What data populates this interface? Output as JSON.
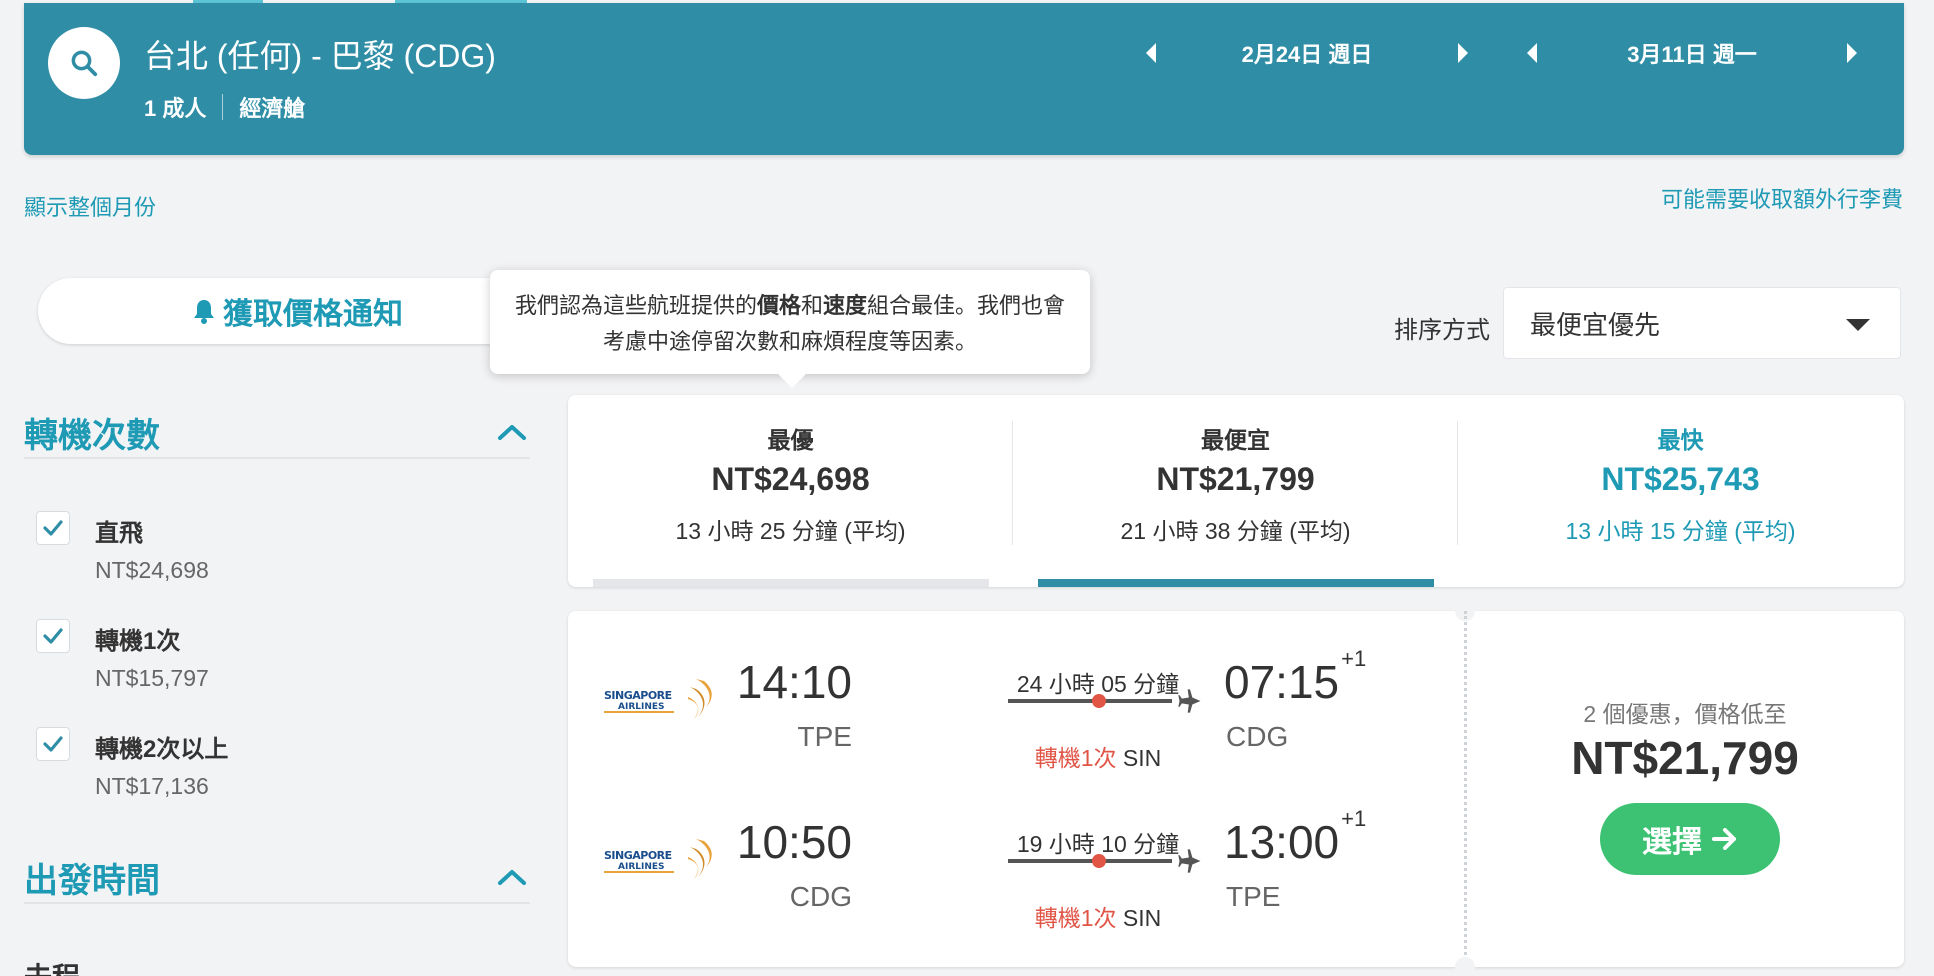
{
  "header": {
    "route": "台北 (任何) - 巴黎 (CDG)",
    "passengers": "1 成人",
    "cabin": "經濟艙",
    "depart_date": "2月24日 週日",
    "return_date": "3月11日 週一"
  },
  "links": {
    "show_month": "顯示整個月份",
    "baggage_fee": "可能需要收取額外行李費"
  },
  "price_alert": {
    "label": "獲取價格通知"
  },
  "tooltip": {
    "part1": "我們認為這些航班提供的",
    "bold1": "價格",
    "part2": "和",
    "bold2": "速度",
    "part3": "組合最佳。我們也會考慮中途停留次數和麻煩程度等因素。"
  },
  "sort": {
    "label": "排序方式",
    "value": "最便宜優先"
  },
  "filters": {
    "stops": {
      "title": "轉機次數",
      "items": [
        {
          "label": "直飛",
          "price": "NT$24,698",
          "checked": true
        },
        {
          "label": "轉機1次",
          "price": "NT$15,797",
          "checked": true
        },
        {
          "label": "轉機2次以上",
          "price": "NT$17,136",
          "checked": true
        }
      ]
    },
    "departure_time": {
      "title": "出發時間",
      "sub": "去程"
    }
  },
  "sort_tabs": [
    {
      "label": "最優",
      "price": "NT$24,698",
      "time": "13 小時 25 分鐘 (平均)",
      "color": "#333333",
      "bar": "#e4e6ea"
    },
    {
      "label": "最便宜",
      "price": "NT$21,799",
      "time": "21 小時 38 分鐘 (平均)",
      "color": "#333333",
      "bar": "#2f8ea6"
    },
    {
      "label": "最快",
      "price": "NT$25,743",
      "time": "13 小時 15 分鐘 (平均)",
      "color": "#1e9ab5",
      "bar": "none"
    }
  ],
  "result": {
    "legs": [
      {
        "airline": "SINGAPORE AIRLINES",
        "dep_time": "14:10",
        "dep_code": "TPE",
        "duration": "24 小時 05 分鐘",
        "stops": "轉機1次",
        "stop_code": "SIN",
        "arr_time": "07:15",
        "arr_offset": "+1",
        "arr_code": "CDG"
      },
      {
        "airline": "SINGAPORE AIRLINES",
        "dep_time": "10:50",
        "dep_code": "CDG",
        "duration": "19 小時 10 分鐘",
        "stops": "轉機1次",
        "stop_code": "SIN",
        "arr_time": "13:00",
        "arr_offset": "+1",
        "arr_code": "TPE"
      }
    ],
    "deals": "2 個優惠，價格低至",
    "price": "NT$21,799",
    "select_label": "選擇"
  },
  "colors": {
    "header": "#2f8ea6",
    "accent": "#1e9ab5",
    "stop_red": "#e05545",
    "select_green": "#3cc272"
  }
}
